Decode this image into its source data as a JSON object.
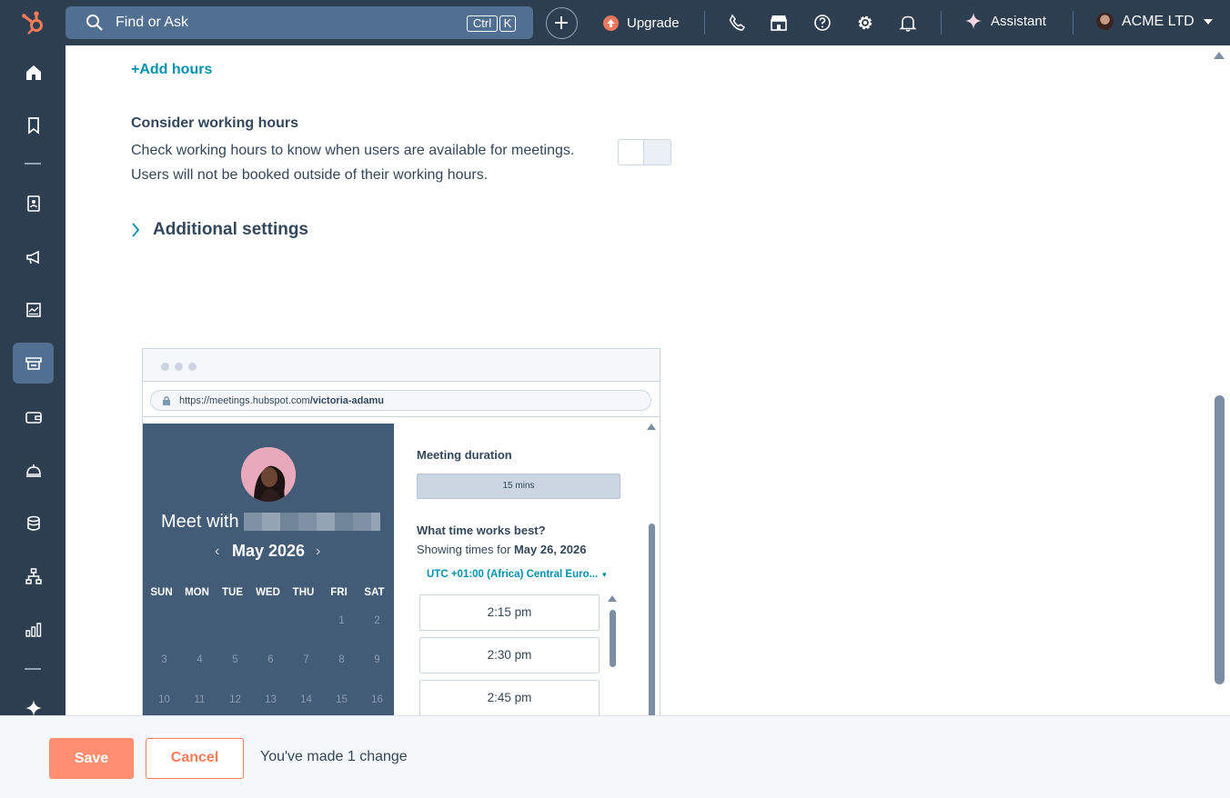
{
  "topbar": {
    "search_placeholder": "Find or Ask",
    "shortcut_ctrl": "Ctrl",
    "shortcut_k": "K",
    "upgrade_label": "Upgrade",
    "assistant_label": "Assistant",
    "account_name": "ACME LTD"
  },
  "content": {
    "add_hours": "+Add hours",
    "consider_title": "Consider working hours",
    "consider_desc_1": "Check working hours to know when users are available for meetings.",
    "consider_desc_2": "Users will not be booked outside of their working hours.",
    "toggle_on": false,
    "additional_settings": "Additional settings"
  },
  "preview": {
    "url_prefix": "https://meetings.hubspot.com",
    "url_path": "/victoria-adamu",
    "meet_with": "Meet with",
    "month": "May 2026",
    "weekdays": [
      "SUN",
      "MON",
      "TUE",
      "WED",
      "THU",
      "FRI",
      "SAT"
    ],
    "days_row1": [
      "1",
      "2"
    ],
    "days_row2": [
      "3",
      "4",
      "5",
      "6",
      "7",
      "8",
      "9"
    ],
    "days_row3": [
      "10",
      "11",
      "12",
      "13",
      "14",
      "15",
      "16"
    ],
    "duration_title": "Meeting duration",
    "duration_value": "15 mins",
    "time_title": "What time works best?",
    "showing_prefix": "Showing times for",
    "showing_date": "May 26, 2026",
    "timezone": "UTC +01:00 (Africa) Central Euro...",
    "slots": [
      "2:15 pm",
      "2:30 pm",
      "2:45 pm"
    ]
  },
  "footer": {
    "save_label": "Save",
    "cancel_label": "Cancel",
    "changes_text": "You've made 1 change"
  },
  "colors": {
    "nav_bg": "#2d3e50",
    "accent_teal": "#0091ae",
    "save_orange": "#ff8f73",
    "cancel_orange": "#ff7a59",
    "calendar_bg": "#425b76"
  }
}
